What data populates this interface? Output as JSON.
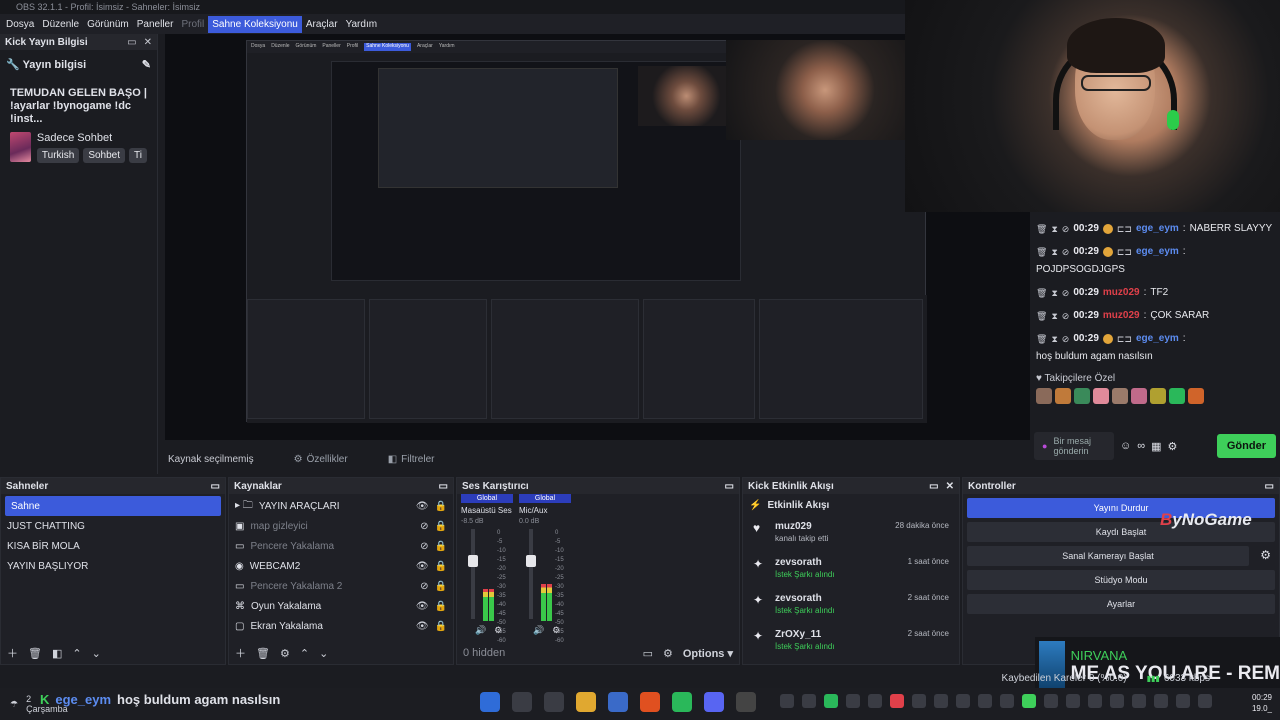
{
  "window": {
    "title": "OBS 32.1.1 - Profil: İsimsiz - Sahneler: İsimsiz"
  },
  "menu": {
    "items": [
      {
        "label": "Dosya",
        "state": ""
      },
      {
        "label": "Düzenle",
        "state": ""
      },
      {
        "label": "Görünüm",
        "state": ""
      },
      {
        "label": "Paneller",
        "state": ""
      },
      {
        "label": "Profil",
        "state": "dim"
      },
      {
        "label": "Sahne Koleksiyonu",
        "state": "active"
      },
      {
        "label": "Araçlar",
        "state": ""
      },
      {
        "label": "Yardım",
        "state": ""
      }
    ]
  },
  "kick_info": {
    "dock_title": "Kick Yayın Bilgisi",
    "header": "Yayın bilgisi",
    "stream_title": "TEMUDAN GELEN BAŞO | !ayarlar !bynogame !dc !inst...",
    "category": "Sadece Sohbet",
    "tags": [
      "Turkish",
      "Sohbet",
      "Ti"
    ]
  },
  "nested_menu": [
    "Dosya",
    "Düzenle",
    "Görünüm",
    "Paneller",
    "Profil",
    "Sahne Koleksiyonu",
    "Araçlar",
    "Yardım"
  ],
  "chat": {
    "messages": [
      {
        "time": "00:29",
        "user": "ege_eym",
        "user_color": "blue",
        "text": "NABERR SLAYYY"
      },
      {
        "time": "00:29",
        "user": "ege_eym",
        "user_color": "blue",
        "text": "POJDPSOGDJGPS"
      },
      {
        "time": "00:29",
        "user": "muz029",
        "user_color": "red",
        "text": "TF2"
      },
      {
        "time": "00:29",
        "user": "muz029",
        "user_color": "red",
        "text": "ÇOK SARAR"
      },
      {
        "time": "00:29",
        "user": "ege_eym",
        "user_color": "blue",
        "text": "hoş buldum agam nasılsın"
      }
    ],
    "followers_label": "Takipçilere Özel",
    "input_placeholder": "Bir mesaj gönderin",
    "send_label": "Gönder"
  },
  "preview_strip": {
    "source_label": "Kaynak seçilmemiş",
    "properties": "Özellikler",
    "filters": "Filtreler"
  },
  "scenes": {
    "title": "Sahneler",
    "items": [
      {
        "label": "Sahne",
        "selected": true
      },
      {
        "label": "JUST CHATTING",
        "selected": false
      },
      {
        "label": "KISA BİR MOLA",
        "selected": false
      },
      {
        "label": "YAYIN BAŞLIYOR",
        "selected": false
      }
    ]
  },
  "sources": {
    "title": "Kaynaklar",
    "items": [
      {
        "label": "YAYIN ARAÇLARI",
        "dim": false,
        "icon": "folder-icon"
      },
      {
        "label": "map gizleyici",
        "dim": true,
        "icon": "image-icon"
      },
      {
        "label": "Pencere Yakalama",
        "dim": true,
        "icon": "window-icon"
      },
      {
        "label": "WEBCAM2",
        "dim": false,
        "icon": "camera-icon"
      },
      {
        "label": "Pencere Yakalama 2",
        "dim": true,
        "icon": "window-icon"
      },
      {
        "label": "Oyun Yakalama",
        "dim": false,
        "icon": "gamepad-icon"
      },
      {
        "label": "Ekran Yakalama",
        "dim": false,
        "icon": "monitor-icon"
      }
    ]
  },
  "mixer": {
    "title": "Ses Karıştırıcı",
    "channels": [
      {
        "global": "Global",
        "name": "Masaüstü Ses",
        "db": "-8.5 dB",
        "level": 0.35
      },
      {
        "global": "Global",
        "name": "Mic/Aux",
        "db": "0.0 dB",
        "level": 0.4
      }
    ],
    "ticks": [
      "0",
      "-5",
      "-10",
      "-15",
      "-20",
      "-25",
      "-30",
      "-35",
      "-40",
      "-45",
      "-50",
      "-55",
      "-60"
    ],
    "hidden": "0 hidden",
    "options": "Options"
  },
  "events": {
    "title": "Kick Etkinlik Akışı",
    "subtitle": "Etkinlik Akışı",
    "items": [
      {
        "name": "muz029",
        "sub": "kanalı takip etti",
        "sub_green": false,
        "time": "28 dakika önce",
        "icon": "heart-icon"
      },
      {
        "name": "zevsorath",
        "sub": "İstek Şarkı alındı",
        "sub_green": true,
        "time": "1 saat önce",
        "icon": "gift-icon"
      },
      {
        "name": "zevsorath",
        "sub": "İstek Şarkı alındı",
        "sub_green": true,
        "time": "2 saat önce",
        "icon": "gift-icon"
      },
      {
        "name": "ZrOXy_11",
        "sub": "İstek Şarkı alındı",
        "sub_green": true,
        "time": "2 saat önce",
        "icon": "gift-icon"
      }
    ]
  },
  "controls": {
    "title": "Kontroller",
    "buttons": [
      "Yayını Durdur",
      "Kaydı Başlat",
      "Sanal Kamerayı Başlat",
      "Stüdyo Modu",
      "Ayarlar"
    ],
    "logo": "ByNoGame"
  },
  "status": {
    "dropped": "Kaybedilen Kareler 0 (%0.0)",
    "bitrate": "6033 kbps"
  },
  "nowplaying": {
    "artist": "NIRVANA",
    "song": "ME AS YOU ARE - REM"
  },
  "taskbar": {
    "weather_line1": "2",
    "weather_line2": "Çarşamba",
    "overlay_user": "ege_eym",
    "overlay_text": "hoş buldum agam nasılsın",
    "clock_time": "00:29",
    "clock_date": "19.0_"
  },
  "colors": {
    "accent": "#3c5bdb",
    "kick_green": "#3ecf5a",
    "chat_blue": "#5c8cf0",
    "chat_red": "#e0404a"
  }
}
